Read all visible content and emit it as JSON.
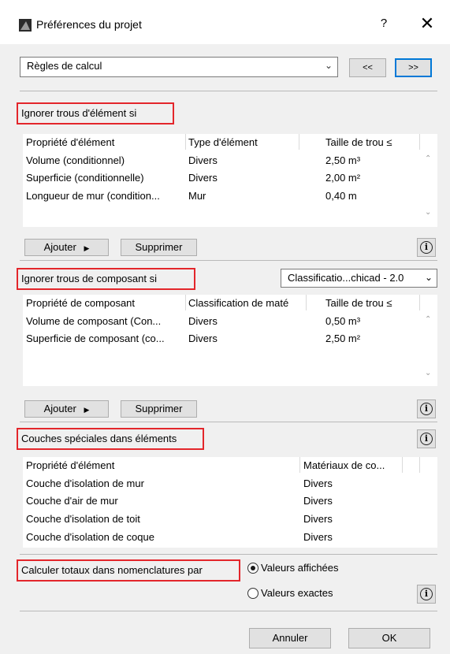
{
  "window": {
    "title": "Préférences du projet",
    "help": "?",
    "close": "✕"
  },
  "nav": {
    "selected": "Règles de calcul",
    "prev": "<<",
    "next": ">>"
  },
  "element_holes": {
    "title": "Ignorer trous d'élément si",
    "headers": [
      "Propriété d'élément",
      "Type d'élément",
      "Taille de trou ≤"
    ],
    "rows": [
      [
        "Volume (conditionnel)",
        "Divers",
        "2,50 m³"
      ],
      [
        "Superficie (conditionnelle)",
        "Divers",
        "2,00 m²"
      ],
      [
        "Longueur de mur (condition...",
        "Mur",
        "0,40 m"
      ]
    ],
    "add": "Ajouter",
    "delete": "Supprimer"
  },
  "component_holes": {
    "title": "Ignorer trous de composant si",
    "classification": "Classificatio...chicad - 2.0",
    "headers": [
      "Propriété de composant",
      "Classification de maté",
      "Taille de trou ≤"
    ],
    "rows": [
      [
        "Volume de composant (Con...",
        "Divers",
        "0,50 m³"
      ],
      [
        "Superficie de composant (co...",
        "Divers",
        "2,50 m²"
      ]
    ],
    "add": "Ajouter",
    "delete": "Supprimer"
  },
  "special_layers": {
    "title": "Couches spéciales dans éléments",
    "headers": [
      "Propriété d'élément",
      "Matériaux de co..."
    ],
    "rows": [
      [
        "Couche d'isolation de mur",
        "Divers"
      ],
      [
        "Couche d'air de mur",
        "Divers"
      ],
      [
        "Couche d'isolation de toit",
        "Divers"
      ],
      [
        "Couche d'isolation de coque",
        "Divers"
      ]
    ]
  },
  "totals": {
    "title": "Calculer totaux dans nomenclatures par",
    "option_displayed": "Valeurs affichées",
    "option_exact": "Valeurs exactes",
    "selected": "Valeurs affichées"
  },
  "footer": {
    "cancel": "Annuler",
    "ok": "OK"
  },
  "colors": {
    "highlight": "#e3262b",
    "focus": "#0078d7"
  },
  "icons": {
    "info": "i",
    "dropdown": "chevron-down",
    "arrow": "triangle-right"
  }
}
